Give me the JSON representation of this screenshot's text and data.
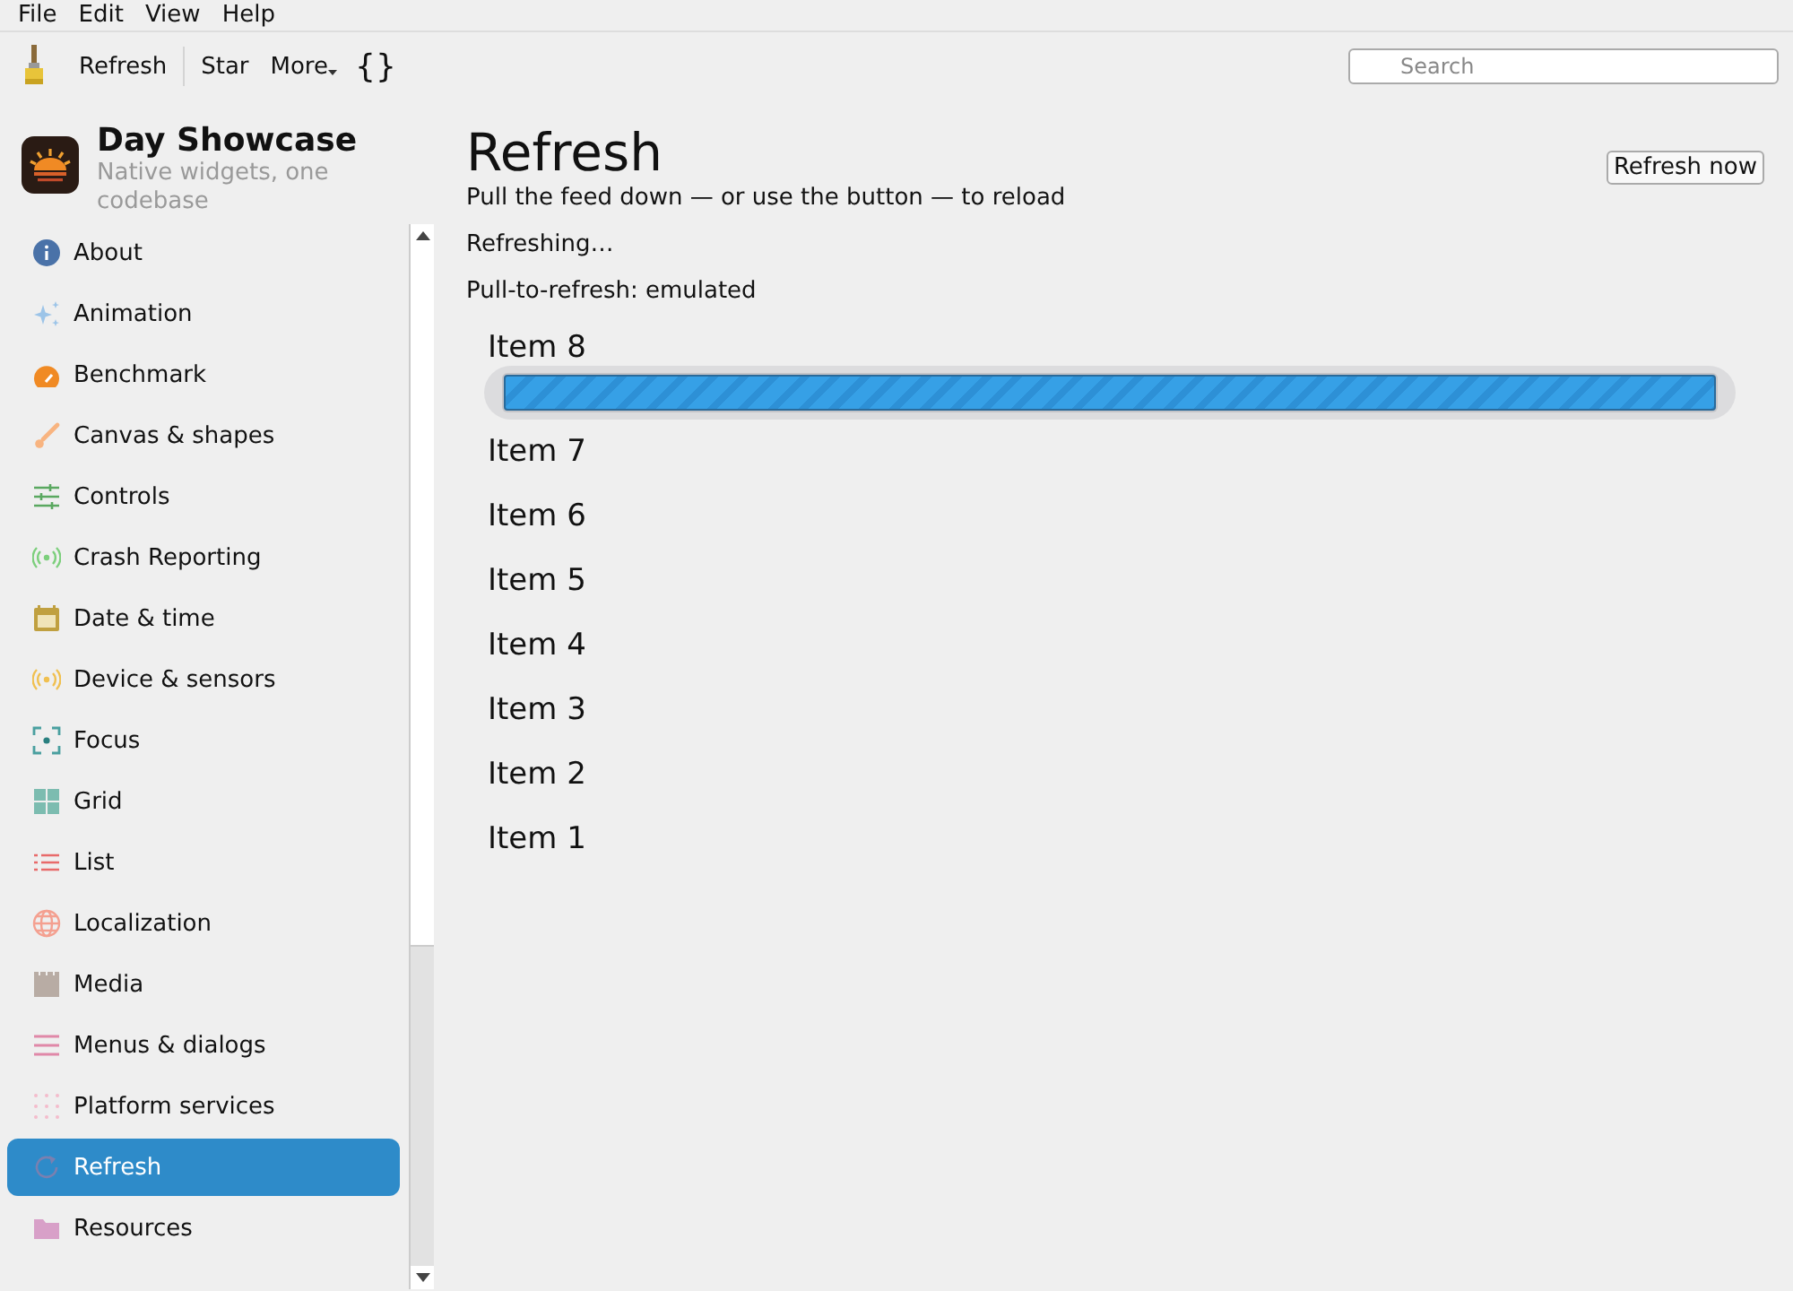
{
  "menu_bar": [
    "File",
    "Edit",
    "View",
    "Help"
  ],
  "toolbar": {
    "buttons": [
      "Refresh",
      "Star",
      "More"
    ],
    "code_label": "{}",
    "search": {
      "placeholder": "Search"
    }
  },
  "app": {
    "title": "Day Showcase",
    "subtitle": "Native widgets, one codebase"
  },
  "sidebar": {
    "items": [
      {
        "label": "About",
        "selected": false
      },
      {
        "label": "Animation",
        "selected": false
      },
      {
        "label": "Benchmark",
        "selected": false
      },
      {
        "label": "Canvas & shapes",
        "selected": false
      },
      {
        "label": "Controls",
        "selected": false
      },
      {
        "label": "Crash Reporting",
        "selected": false
      },
      {
        "label": "Date & time",
        "selected": false
      },
      {
        "label": "Device & sensors",
        "selected": false
      },
      {
        "label": "Focus",
        "selected": false
      },
      {
        "label": "Grid",
        "selected": false
      },
      {
        "label": "List",
        "selected": false
      },
      {
        "label": "Localization",
        "selected": false
      },
      {
        "label": "Media",
        "selected": false
      },
      {
        "label": "Menus & dialogs",
        "selected": false
      },
      {
        "label": "Platform services",
        "selected": false
      },
      {
        "label": "Refresh",
        "selected": true
      },
      {
        "label": "Resources",
        "selected": false
      }
    ]
  },
  "page": {
    "title": "Refresh",
    "subtitle": "Pull the feed down — or use the button — to reload",
    "button": "Refresh now",
    "status": "Refreshing…",
    "mode": "Pull-to-refresh: emulated",
    "progress": {
      "level": 1
    },
    "items": [
      "Item 8",
      "Item 7",
      "Item 6",
      "Item 5",
      "Item 4",
      "Item 3",
      "Item 2",
      "Item 1"
    ]
  }
}
